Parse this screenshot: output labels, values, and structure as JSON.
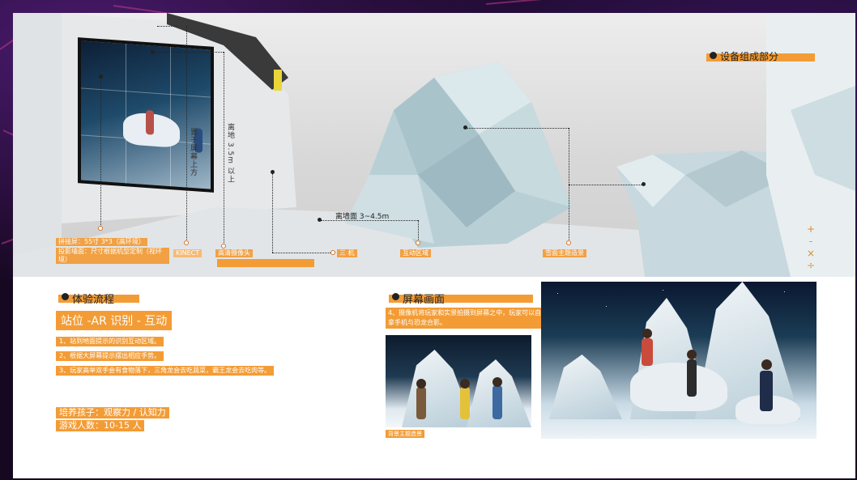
{
  "render": {
    "section_title": "设备组成部分",
    "labels": {
      "screen_spec": "拼接屏：55寸 3*3（高环境）",
      "projection_spec": "投影墙面：尺寸根据机型定制（视环境）",
      "kinect": "KINECT",
      "camera": "高清摄像头",
      "projector": "三 机",
      "interaction_zone": "互动区域",
      "scene_sculpture": "雪面主题造景",
      "wall_distance": "离墙面 3~4.5m",
      "mount_above": "置于屏幕上方",
      "height_above": "离地 3.5m 以上"
    },
    "side_glyphs": [
      "+",
      "-",
      "×",
      "÷"
    ]
  },
  "flow": {
    "section_title": "体验流程",
    "headline": "站位 -AR 识别 - 互动",
    "steps": [
      "1、站到地面提示的识别互动区域。",
      "2、根据大屏幕提示摆出相应手势。",
      "3、玩家高举双手会有食物落下，三角龙会去吃蔬菜，霸王龙会去吃肉等。"
    ],
    "cultivate": "培养孩子：观察力 / 认知力",
    "players": "游戏人数：10-15 人"
  },
  "screen": {
    "section_title": "屏幕画面",
    "description": "4、摄像机将玩家和实景拍摄到屏幕之中，玩家可以自己拿手机与恐龙合影。",
    "photo_caption": "背景主题造景"
  },
  "colors": {
    "accent": "#f39c36",
    "sheet_bg": "#ffffff",
    "frame_bg": "#160820"
  }
}
